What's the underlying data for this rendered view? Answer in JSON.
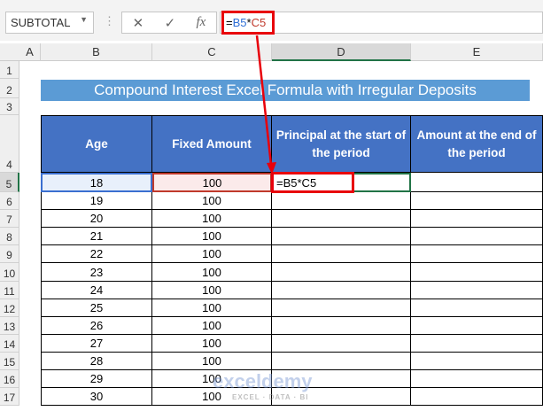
{
  "formula_bar": {
    "name_box": "SUBTOTAL",
    "cancel_icon": "✕",
    "enter_icon": "✓",
    "fx_label": "fx",
    "formula_eq": "=",
    "formula_b": "B5",
    "formula_star": "*",
    "formula_c": "C5"
  },
  "columns": [
    "A",
    "B",
    "C",
    "D",
    "E"
  ],
  "rows": [
    "1",
    "2",
    "3",
    "4",
    "5",
    "6",
    "7",
    "8",
    "9",
    "10",
    "11",
    "12",
    "13",
    "14",
    "15",
    "16",
    "17"
  ],
  "title": "Compound Interest Excel Formula with Irregular Deposits",
  "headers": [
    "Age",
    "Fixed Amount",
    "Principal at the start of the period",
    "Amount at the end of the period"
  ],
  "table": [
    [
      "18",
      "100",
      "=B5*C5"
    ],
    [
      "19",
      "100"
    ],
    [
      "20",
      "100"
    ],
    [
      "21",
      "100"
    ],
    [
      "22",
      "100"
    ],
    [
      "23",
      "100"
    ],
    [
      "24",
      "100"
    ],
    [
      "25",
      "100"
    ],
    [
      "26",
      "100"
    ],
    [
      "27",
      "100"
    ],
    [
      "28",
      "100"
    ],
    [
      "29",
      "100"
    ],
    [
      "30",
      "100"
    ]
  ],
  "watermark": {
    "name": "exceldemy",
    "tagline": "EXCEL · DATA · BI"
  },
  "colors": {
    "header": "#4472c4",
    "title": "#5b9bd5",
    "highlight": "#e8000b"
  }
}
